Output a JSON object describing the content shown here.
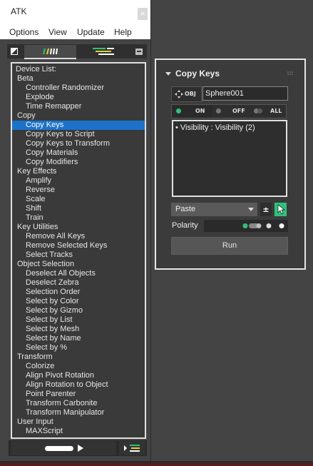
{
  "window": {
    "title": "ATK",
    "close_glyph": "×"
  },
  "menu": [
    "Options",
    "View",
    "Update",
    "Help"
  ],
  "device_list": [
    {
      "label": "Device List:",
      "level": 0,
      "selected": false
    },
    {
      "label": "Beta",
      "level": 1,
      "selected": false
    },
    {
      "label": "Controller Randomizer",
      "level": 2,
      "selected": false
    },
    {
      "label": "Explode",
      "level": 2,
      "selected": false
    },
    {
      "label": "Time Remapper",
      "level": 2,
      "selected": false
    },
    {
      "label": "Copy",
      "level": 1,
      "selected": false
    },
    {
      "label": "Copy Keys",
      "level": 2,
      "selected": true
    },
    {
      "label": "Copy Keys to Script",
      "level": 2,
      "selected": false
    },
    {
      "label": "Copy Keys to Transform",
      "level": 2,
      "selected": false
    },
    {
      "label": "Copy Materials",
      "level": 2,
      "selected": false
    },
    {
      "label": "Copy Modifiers",
      "level": 2,
      "selected": false
    },
    {
      "label": "Key Effects",
      "level": 1,
      "selected": false
    },
    {
      "label": "Amplify",
      "level": 2,
      "selected": false
    },
    {
      "label": "Reverse",
      "level": 2,
      "selected": false
    },
    {
      "label": "Scale",
      "level": 2,
      "selected": false
    },
    {
      "label": "Shift",
      "level": 2,
      "selected": false
    },
    {
      "label": "Train",
      "level": 2,
      "selected": false
    },
    {
      "label": "Key Utilities",
      "level": 1,
      "selected": false
    },
    {
      "label": "Remove All Keys",
      "level": 2,
      "selected": false
    },
    {
      "label": "Remove Selected Keys",
      "level": 2,
      "selected": false
    },
    {
      "label": "Select Tracks",
      "level": 2,
      "selected": false
    },
    {
      "label": "Object Selection",
      "level": 1,
      "selected": false
    },
    {
      "label": "Deselect All Objects",
      "level": 2,
      "selected": false
    },
    {
      "label": "Deselect Zebra",
      "level": 2,
      "selected": false
    },
    {
      "label": "Selection Order",
      "level": 2,
      "selected": false
    },
    {
      "label": "Select by Color",
      "level": 2,
      "selected": false
    },
    {
      "label": "Select by Gizmo",
      "level": 2,
      "selected": false
    },
    {
      "label": "Select by List",
      "level": 2,
      "selected": false
    },
    {
      "label": "Select by Mesh",
      "level": 2,
      "selected": false
    },
    {
      "label": "Select by Name",
      "level": 2,
      "selected": false
    },
    {
      "label": "Select by %",
      "level": 2,
      "selected": false
    },
    {
      "label": "Transform",
      "level": 1,
      "selected": false
    },
    {
      "label": "Colorize",
      "level": 2,
      "selected": false
    },
    {
      "label": "Align Pivot Rotation",
      "level": 2,
      "selected": false
    },
    {
      "label": "Align Rotation to Object",
      "level": 2,
      "selected": false
    },
    {
      "label": "Point Parenter",
      "level": 2,
      "selected": false
    },
    {
      "label": "Transform Carbonite",
      "level": 2,
      "selected": false
    },
    {
      "label": "Transform Manipulator",
      "level": 2,
      "selected": false
    },
    {
      "label": "User Input",
      "level": 1,
      "selected": false
    },
    {
      "label": "MAXScript",
      "level": 2,
      "selected": false
    }
  ],
  "panel": {
    "title": "Copy Keys",
    "obj_label": "OBJ",
    "object_value": "Sphere001",
    "toggle_on": "ON",
    "toggle_off": "OFF",
    "toggle_all": "ALL",
    "tracks": [
      "• Visibility : Visibility (2)"
    ],
    "mode_value": "Paste",
    "plusminus": "±",
    "polarity_label": "Polarity",
    "run_label": "Run"
  },
  "colors": {
    "selection": "#1c72c9",
    "accent_green": "#2ec27e",
    "toggle_on_dot": "#2ec27e"
  },
  "icons": [
    "scroll-collapse-icon",
    "graph-bars-icon",
    "list-icon",
    "toolbox-icon",
    "play-icon",
    "dropdown-arrow-icon",
    "cursor-icon",
    "move-icon",
    "grip-icon"
  ]
}
